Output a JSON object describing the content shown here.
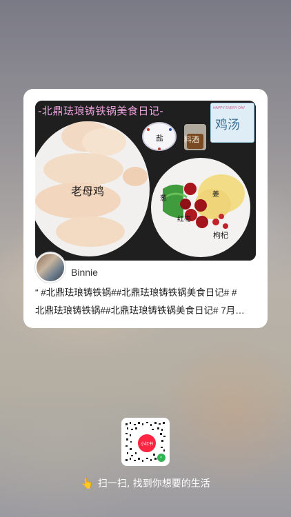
{
  "card": {
    "photo": {
      "title": "-北鼎珐琅铸铁锅美食日记-",
      "labels": {
        "chicken": "老母鸡",
        "salt": "盐",
        "wine": "料酒",
        "ginger": "姜",
        "scallion": "葱",
        "date": "红枣",
        "goji": "枸杞"
      },
      "soup_tag": {
        "small_text": "HAPPY EVERY DAY",
        "big_text": "鸡汤"
      }
    },
    "author": {
      "name": "Binnie"
    },
    "description": {
      "line1": "“ #北鼎珐琅铸铁锅##北鼎珐琅铸铁锅美食日记# #",
      "line2": "北鼎珐琅铸铁锅##北鼎珐琅铸铁锅美食日记# 7月…"
    }
  },
  "qr": {
    "badge": "小红书"
  },
  "scan_tip": {
    "icon": "pointing-hand-icon",
    "text": "扫一扫, 找到你想要的生活"
  }
}
